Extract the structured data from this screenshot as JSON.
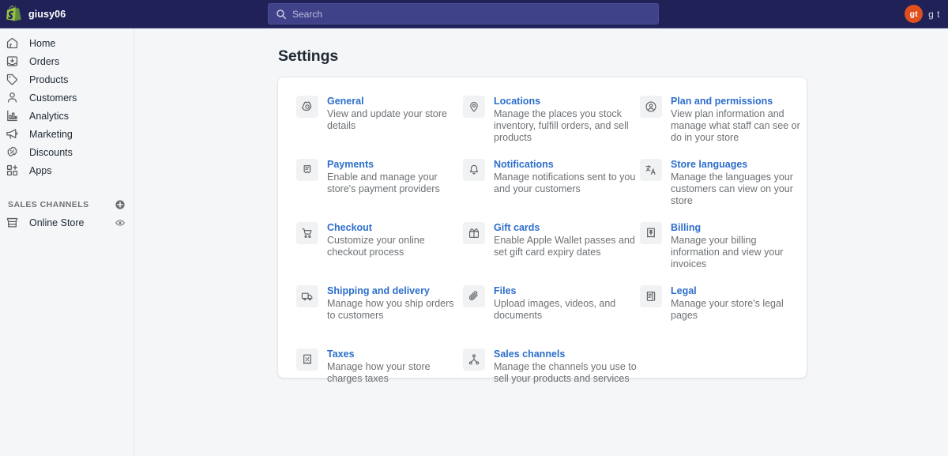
{
  "topbar": {
    "brand_name": "giusy06",
    "logo_icon": "shopify-bag-icon",
    "search": {
      "icon": "search-icon",
      "placeholder": "Search",
      "value": ""
    },
    "user": {
      "avatar_initials": "gt",
      "avatar_color": "#e0501e",
      "name": "g t"
    },
    "background_color": "#1f2157"
  },
  "sidebar": {
    "items": [
      {
        "label": "Home",
        "icon": "home-icon"
      },
      {
        "label": "Orders",
        "icon": "orders-inbox-icon"
      },
      {
        "label": "Products",
        "icon": "products-tag-icon"
      },
      {
        "label": "Customers",
        "icon": "customers-person-icon"
      },
      {
        "label": "Analytics",
        "icon": "analytics-bar-chart-icon"
      },
      {
        "label": "Marketing",
        "icon": "marketing-megaphone-icon"
      },
      {
        "label": "Discounts",
        "icon": "discounts-percent-badge-icon"
      },
      {
        "label": "Apps",
        "icon": "apps-grid-plus-icon"
      }
    ],
    "sales_channels": {
      "title": "SALES CHANNELS",
      "add_icon": "plus-circle-icon",
      "channels": [
        {
          "label": "Online Store",
          "icon": "storefront-icon",
          "action_icon": "eye-icon"
        }
      ]
    }
  },
  "main": {
    "page_title": "Settings",
    "settings": [
      {
        "title": "General",
        "description": "View and update your store details",
        "icon": "gear-icon"
      },
      {
        "title": "Locations",
        "description": "Manage the places you stock inventory, fulfill orders, and sell products",
        "icon": "map-pin-icon"
      },
      {
        "title": "Plan and permissions",
        "description": "View plan information and manage what staff can see or do in your store",
        "icon": "person-circle-icon"
      },
      {
        "title": "Payments",
        "description": "Enable and manage your store's payment providers",
        "icon": "payment-cards-icon"
      },
      {
        "title": "Notifications",
        "description": "Manage notifications sent to you and your customers",
        "icon": "bell-icon"
      },
      {
        "title": "Store languages",
        "description": "Manage the languages your customers can view on your store",
        "icon": "translate-icon"
      },
      {
        "title": "Checkout",
        "description": "Customize your online checkout process",
        "icon": "shopping-cart-icon"
      },
      {
        "title": "Gift cards",
        "description": "Enable Apple Wallet passes and set gift card expiry dates",
        "icon": "gift-icon"
      },
      {
        "title": "Billing",
        "description": "Manage your billing information and view your invoices",
        "icon": "billing-receipt-icon"
      },
      {
        "title": "Shipping and delivery",
        "description": "Manage how you ship orders to customers",
        "icon": "delivery-truck-icon"
      },
      {
        "title": "Files",
        "description": "Upload images, videos, and documents",
        "icon": "paperclip-icon"
      },
      {
        "title": "Legal",
        "description": "Manage your store's legal pages",
        "icon": "legal-document-icon"
      },
      {
        "title": "Taxes",
        "description": "Manage how your store charges taxes",
        "icon": "taxes-percent-icon"
      },
      {
        "title": "Sales channels",
        "description": "Manage the channels you use to sell your products and services",
        "icon": "sales-channels-hierarchy-icon"
      }
    ]
  },
  "colors": {
    "nav_background": "#1f2157",
    "link_blue": "#2c6ecb",
    "page_background": "#f4f6f8",
    "card_background": "#ffffff",
    "text_primary": "#212b36",
    "text_secondary": "#6d7175",
    "accent_orange": "#e0501e"
  }
}
